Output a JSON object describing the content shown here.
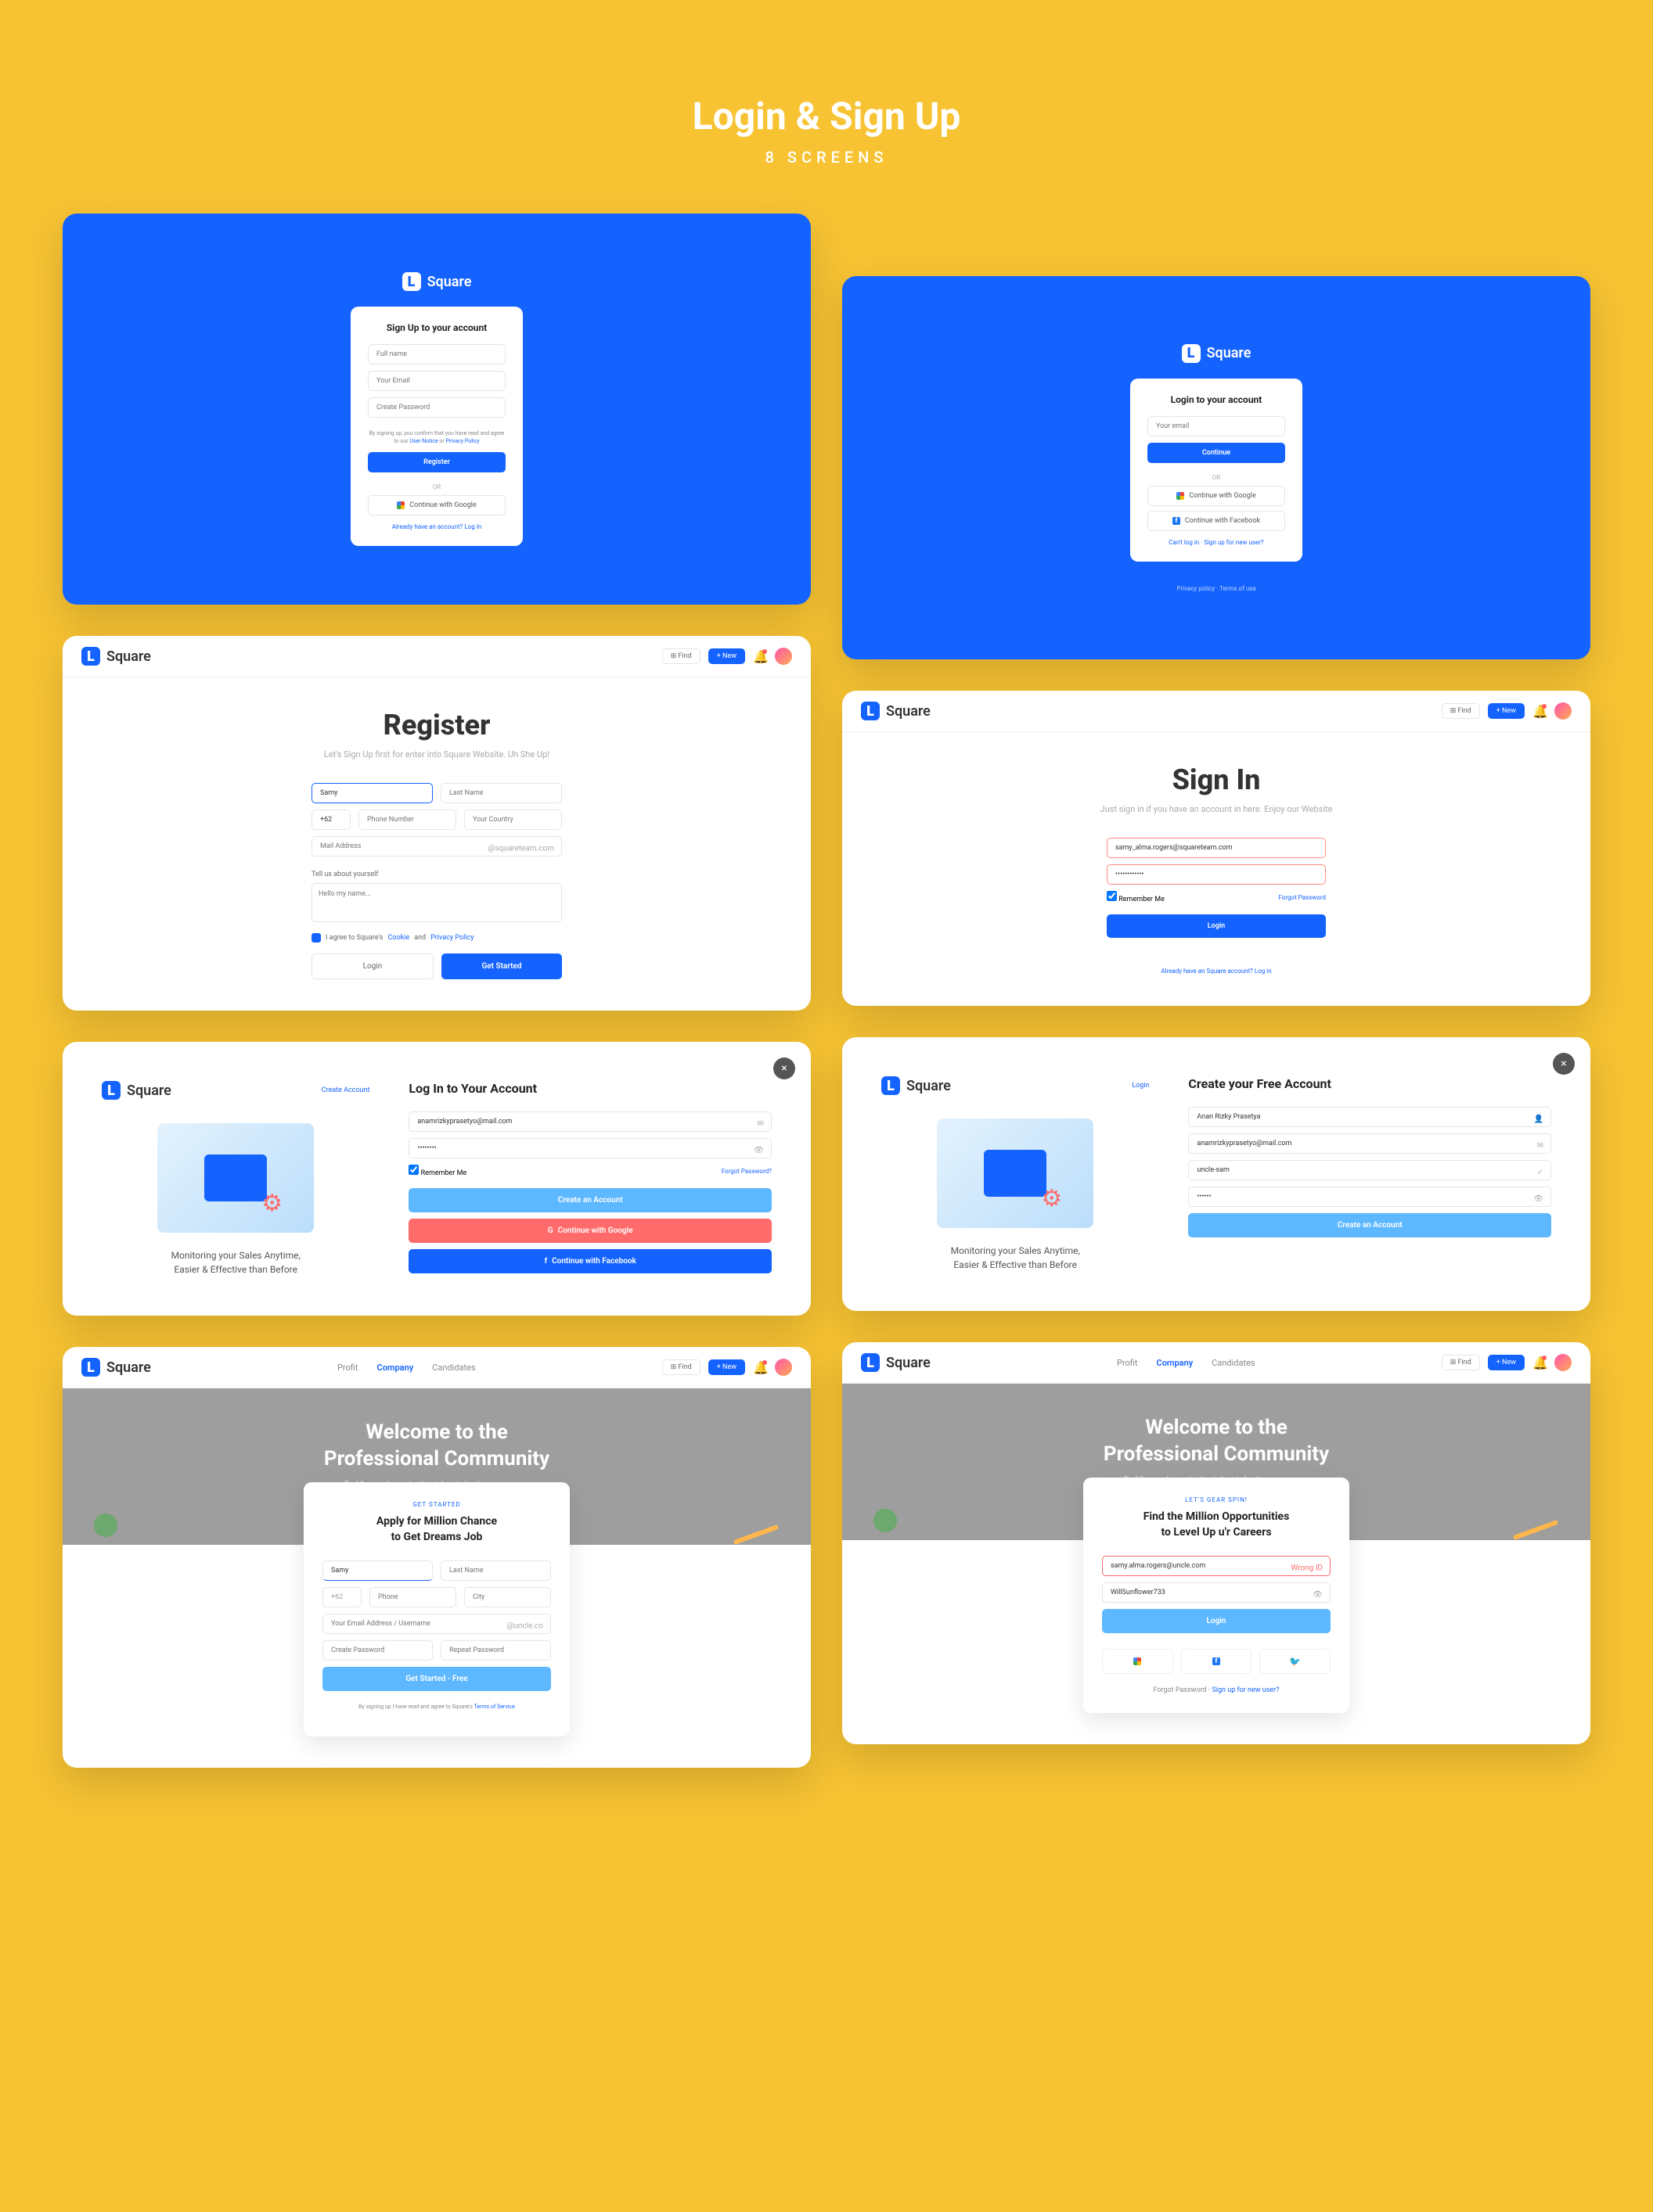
{
  "header": {
    "title": "Login & Sign Up",
    "subtitle": "8 SCREENS"
  },
  "brand": {
    "name": "Square",
    "icon": "L"
  },
  "s1": {
    "title": "Sign Up to your account",
    "fullname_ph": "Full name",
    "email_ph": "Your Email",
    "password_ph": "Create Password",
    "terms": "By signing up, you confirm that you have read and agree to our",
    "terms_link1": "User Notice",
    "terms_link2": "Privacy Policy",
    "register": "Register",
    "or": "OR",
    "google": "Continue with Google",
    "footer": "Already have an account? Log In"
  },
  "s2": {
    "title": "Login to your account",
    "email_ph": "Your email",
    "continue": "Continue",
    "or": "OR",
    "google": "Continue with Google",
    "facebook": "Continue with Facebook",
    "cant": "Can't log in",
    "signup": "Sign up for new user?",
    "footer1": "Privacy policy",
    "footer2": "Terms of use"
  },
  "s3": {
    "heading": "Register",
    "sub": "Let's Sign Up first for enter into Square Website. Uh She Up!",
    "firstname": "Samy",
    "lastname_ph": "Last Name",
    "code": "+62",
    "phone_ph": "Phone Number",
    "country_ph": "Your Country",
    "email_ph": "Mail Address",
    "email_suffix": "@squareteam.com",
    "about_label": "Tell us about yourself",
    "about_ph": "Hello my name...",
    "check_label": "I agree to Square's",
    "check_link1": "Cookie",
    "check_link2": "Privacy Policy",
    "login": "Login",
    "submit": "Get Started",
    "nav_find": "Find",
    "nav_new": "+ New"
  },
  "s4": {
    "heading": "Sign In",
    "sub": "Just sign in if you have an account in here. Enjoy our Website",
    "email": "samy_alma.rogers@squareteam.com",
    "password": "••••••••••••",
    "remember": "Remember Me",
    "forgot": "Forgot Password",
    "login": "Login",
    "footer": "Already have an Square account? Log in"
  },
  "s5": {
    "make": "Create Account",
    "title": "Log In to Your Account",
    "email": "anamrizkyprasetyo@mail.com",
    "password": "••••••••",
    "remember": "Remember Me",
    "forgot": "Forgot Password?",
    "login_btn": "Create an Account",
    "google": "Continue with Google",
    "facebook": "Continue with Facebook",
    "tagline_l1": "Monitoring your Sales Anytime,",
    "tagline_l2": "Easier & Effective than Before"
  },
  "s6": {
    "login": "Login",
    "title": "Create your Free Account",
    "name": "Anan Rizky Prasetya",
    "email": "anamrizkyprasetyo@mail.com",
    "username": "uncle-sam",
    "password": "••••••",
    "btn": "Create an Account",
    "tagline_l1": "Monitoring your Sales Anytime,",
    "tagline_l2": "Easier & Effective than Before"
  },
  "s7": {
    "hero_l1": "Welcome to the",
    "hero_l2": "Professional Community",
    "hero_sub": "Find thousand opportunities in here to level up your careers",
    "label": "GET STARTED",
    "title_l1": "Apply for Million Chance",
    "title_l2": "to Get Dreams Job",
    "firstname": "Samy",
    "lastname_ph": "Last Name",
    "code": "+62",
    "phone_ph": "Phone",
    "city_ph": "City",
    "email_ph": "Your Email Address / Username",
    "suffix": "@uncle.co",
    "pw1_ph": "Create Password",
    "pw2_ph": "Repeat Password",
    "btn": "Get Started - Free",
    "terms": "By signing up I have read and agree to Square's",
    "terms_link": "Terms of Service",
    "nav": {
      "profit": "Profit",
      "company": "Company",
      "candidates": "Candidates"
    }
  },
  "s8": {
    "hero_l1": "Welcome to the",
    "hero_l2": "Professional Community",
    "hero_sub": "Find thousand opportunities in here to level up your careers",
    "label": "LET'S GEAR SPIN!",
    "title_l1": "Find the Million Opportunities",
    "title_l2": "to Level Up u'r Careers",
    "email": "samy.alma.rogers@uncle.com",
    "err": "Wrong ID",
    "password": "WillSunflower733",
    "btn": "Login",
    "link1": "Forgot Password",
    "link2": "Sign up for new user?"
  }
}
